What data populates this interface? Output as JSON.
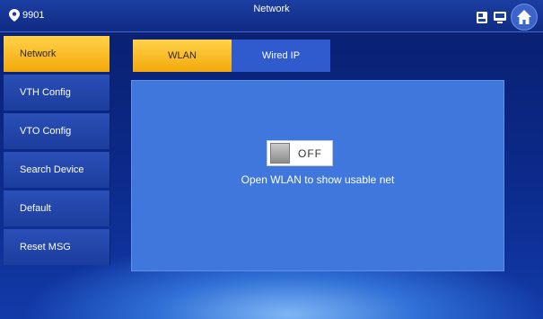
{
  "header": {
    "room_number": "9901",
    "title": "Network"
  },
  "sidebar": {
    "items": [
      {
        "label": "Network"
      },
      {
        "label": "VTH Config"
      },
      {
        "label": "VTO Config"
      },
      {
        "label": "Search Device"
      },
      {
        "label": "Default"
      },
      {
        "label": "Reset MSG"
      }
    ]
  },
  "tabs": [
    {
      "label": "WLAN"
    },
    {
      "label": "Wired IP"
    }
  ],
  "wlan": {
    "toggle_state": "OFF",
    "hint": "Open WLAN to show usable net"
  },
  "colors": {
    "accent": "#f3a80a",
    "panel": "#3f77dc",
    "sidebar": "#1c3d9d"
  },
  "icons": [
    "location-pin-icon",
    "sd-card-icon",
    "monitor-icon",
    "home-icon"
  ]
}
